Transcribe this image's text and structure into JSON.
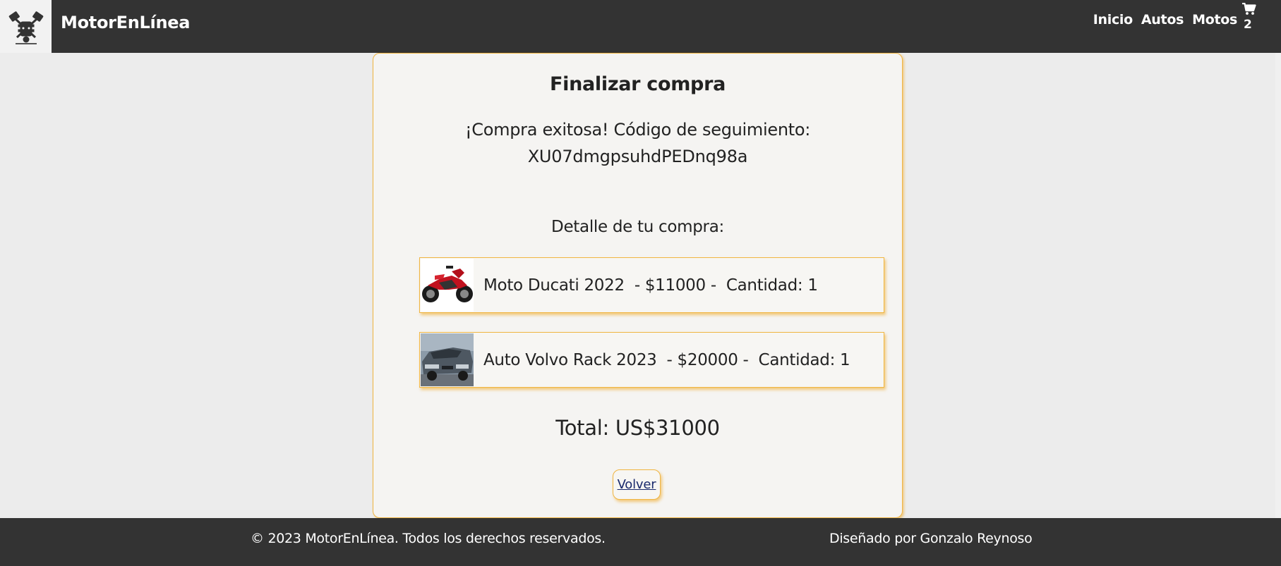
{
  "header": {
    "brand": "MotorEnLínea",
    "logo_icon": "engine-pistons-icon",
    "nav": [
      "Inicio",
      "Autos",
      "Motos"
    ],
    "cart_icon": "shopping-cart-icon",
    "cart_count": "2"
  },
  "checkout": {
    "title": "Finalizar compra",
    "success_message": "¡Compra exitosa! Código de seguimiento:",
    "tracking_code": "XU07dmgpsuhdPEDnq98a",
    "detail_heading": "Detalle de tu compra:",
    "items": [
      {
        "text": "Moto Ducati 2022  - $11000 -  Cantidad: 1",
        "thumbnail": "red-motorcycle-photo"
      },
      {
        "text": "Auto Volvo Rack 2023  - $20000 -  Cantidad: 1",
        "thumbnail": "gray-car-photo"
      }
    ],
    "total": "Total: US$31000",
    "back_label": "Volver"
  },
  "footer": {
    "copyright": "© 2023 MotorEnLínea. Todos los derechos reservados.",
    "credit": "Diseñado por Gonzalo Reynoso"
  },
  "colors": {
    "header_bg": "#333333",
    "page_bg": "#ececec",
    "card_bg": "#f5f4f2",
    "accent_border": "#f0b542",
    "link_color": "#1a2a6c"
  }
}
